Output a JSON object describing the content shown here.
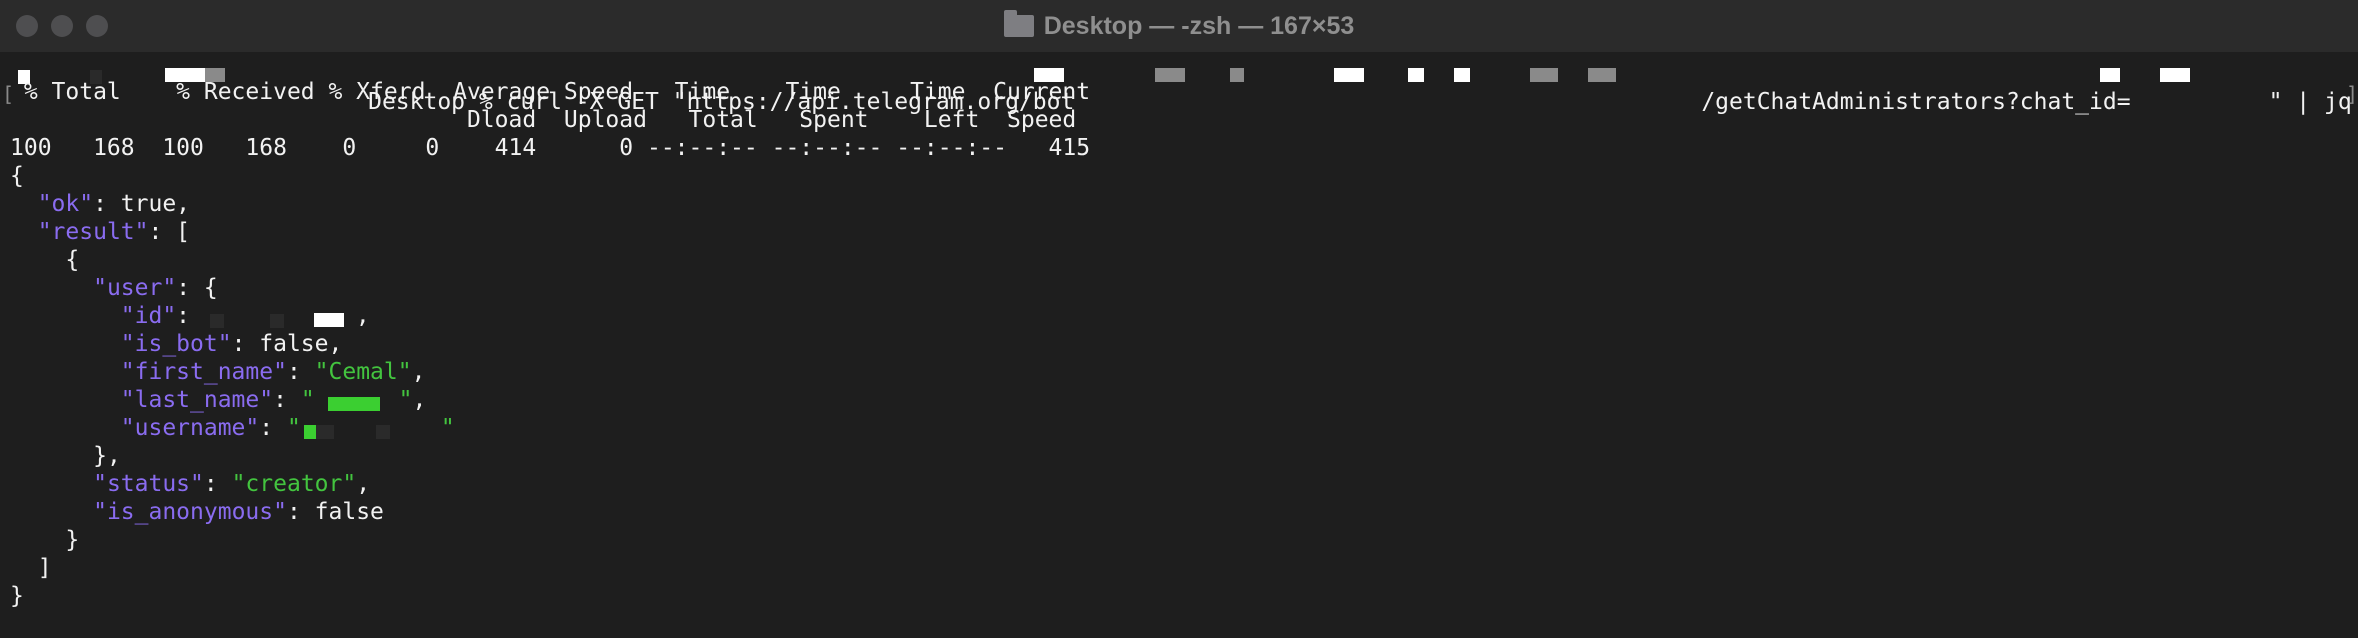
{
  "window": {
    "title": "Desktop — -zsh — 167×53",
    "icon": "folder-icon"
  },
  "terminal": {
    "prompt_line_start": "Desktop % curl -X GET \"https://api.telegram.org/bot",
    "prompt_line_mid": "/getChatAdministrators?chat_id=",
    "prompt_line_end": "\" | jq",
    "progress_header_1": " % Total    % Received % Xferd  Average Speed   Time    Time     Time  Current",
    "progress_header_2": "                                 Dload  Upload   Total   Spent    Left  Speed",
    "progress_values": "100   168  100   168    0     0    414      0 --:--:-- --:--:-- --:--:--   415",
    "json": {
      "open_brace": "{",
      "ok_key": "\"ok\"",
      "ok_val": ": true,",
      "result_key": "\"result\"",
      "result_val": ": [",
      "item_open": "{",
      "user_key": "\"user\"",
      "user_val": ": {",
      "id_key": "\"id\"",
      "id_sep": ": ",
      "id_tail": ",",
      "is_bot_key": "\"is_bot\"",
      "is_bot_val": ": false,",
      "first_name_key": "\"first_name\"",
      "first_name_sep": ": ",
      "first_name_val": "\"Cemal\"",
      "first_name_tail": ",",
      "last_name_key": "\"last_name\"",
      "last_name_sep": ": ",
      "last_name_open": "\"",
      "last_name_close": "\"",
      "last_name_tail": ",",
      "username_key": "\"username\"",
      "username_sep": ": ",
      "username_open": "\"",
      "username_close": "\"",
      "user_close": "},",
      "status_key": "\"status\"",
      "status_sep": ": ",
      "status_val": "\"creator\"",
      "status_tail": ",",
      "is_anonymous_key": "\"is_anonymous\"",
      "is_anonymous_val": ": false",
      "item_close": "}",
      "result_close": "]",
      "close_brace": "}"
    }
  },
  "colors": {
    "background": "#1e1e1e",
    "key": "#8a6cf0",
    "string": "#43c43f",
    "text": "#f2f2f2"
  }
}
